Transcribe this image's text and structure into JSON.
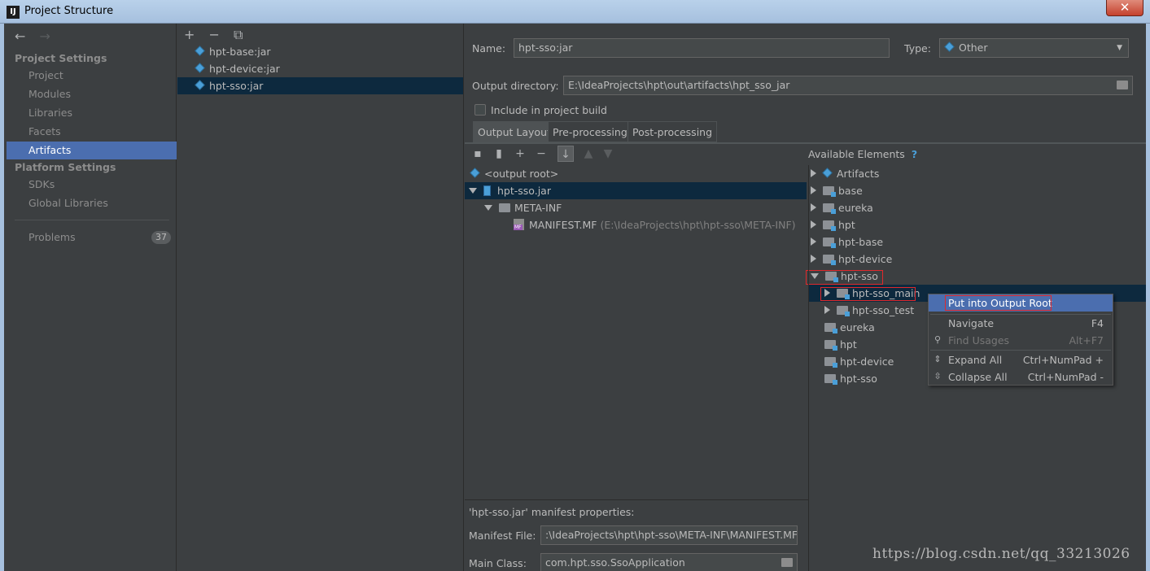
{
  "window": {
    "title": "Project Structure",
    "app_icon": "IJ",
    "close_label": "✕"
  },
  "nav": {
    "back_icon": "←",
    "forward_icon": "→",
    "project_settings_heading": "Project Settings",
    "project_settings_items": [
      "Project",
      "Modules",
      "Libraries",
      "Facets",
      "Artifacts"
    ],
    "platform_settings_heading": "Platform Settings",
    "platform_settings_items": [
      "SDKs",
      "Global Libraries"
    ],
    "problems_label": "Problems",
    "problems_count": "37",
    "selected": "Artifacts"
  },
  "artifact_list": {
    "toolbar": {
      "add": "+",
      "remove": "−",
      "copy": "⧉"
    },
    "items": [
      "hpt-base:jar",
      "hpt-device:jar",
      "hpt-sso:jar"
    ],
    "selected": "hpt-sso:jar"
  },
  "detail": {
    "name_label": "Name:",
    "name_value": "hpt-sso:jar",
    "type_label": "Type:",
    "type_value": "Other",
    "output_dir_label": "Output directory:",
    "output_dir_value": "E:\\IdeaProjects\\hpt\\out\\artifacts\\hpt_sso_jar",
    "include_label": "Include in project build",
    "tabs": [
      "Output Layout",
      "Pre-processing",
      "Post-processing"
    ],
    "active_tab": "Output Layout"
  },
  "output_layout": {
    "rows": [
      {
        "label": "<output root>"
      },
      {
        "label": "hpt-sso.jar"
      },
      {
        "label": "META-INF"
      },
      {
        "label": "MANIFEST.MF",
        "extra": "(E:\\IdeaProjects\\hpt\\hpt-sso\\META-INF)"
      }
    ]
  },
  "available": {
    "heading": "Available Elements",
    "help": "?",
    "rows": [
      "Artifacts",
      "base",
      "eureka",
      "hpt",
      "hpt-base",
      "hpt-device",
      "hpt-sso",
      "hpt-sso_main",
      "hpt-sso_test",
      "eureka",
      "hpt",
      "hpt-device",
      "hpt-sso"
    ]
  },
  "context_menu": {
    "items": [
      {
        "label": "Put into Output Root",
        "shortcut": ""
      },
      {
        "label": "Navigate",
        "shortcut": "F4"
      },
      {
        "label": "Find Usages",
        "shortcut": "Alt+F7"
      },
      {
        "label": "Expand All",
        "shortcut": "Ctrl+NumPad +"
      },
      {
        "label": "Collapse All",
        "shortcut": "Ctrl+NumPad -"
      }
    ]
  },
  "manifest": {
    "heading": "'hpt-sso.jar' manifest properties:",
    "file_label": "Manifest File:",
    "file_value": ":\\IdeaProjects\\hpt\\hpt-sso\\META-INF\\MANIFEST.MF",
    "main_class_label": "Main Class:",
    "main_class_value": "com.hpt.sso.SsoApplication"
  },
  "watermark": "https://blog.csdn.net/qq_33213026"
}
